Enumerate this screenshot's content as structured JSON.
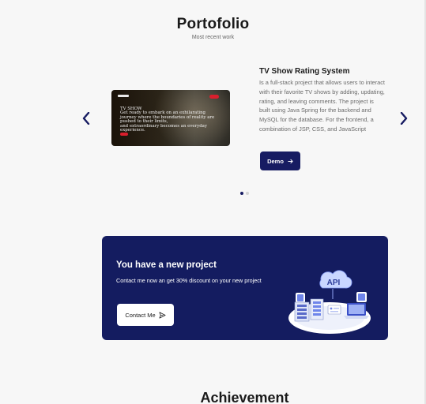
{
  "portfolio": {
    "title": "Portofolio",
    "subtitle": "Most recent work"
  },
  "carousel": {
    "prev_icon": "chevron-left-icon",
    "next_icon": "chevron-right-icon",
    "active_index": 0,
    "total": 2,
    "project": {
      "title": "TV Show Rating System",
      "description": "Is a full-stack project that allows users to interact with their favorite TV shows by adding, updating, rating, and leaving comments. The project is built using Java Spring for the backend and MySQL for the database. For the frontend, a combination of JSP, CSS, and JavaScript",
      "demo_label": "Demo",
      "image_text": "TV SHOW\nGet ready to embark on an exhilarating journey where the boundaries of reality are pushed to their limits,\nand extraordinary becomes an everyday experience."
    }
  },
  "cta": {
    "title": "You have a new project",
    "text": "Contact me now an get 30% discount on your new project",
    "button_label": "Contact Me",
    "illustration_label": "API"
  },
  "achievement": {
    "title": "Achievement"
  },
  "colors": {
    "primary": "#171c62",
    "banner": "#141c60",
    "background": "#f7f7f7",
    "accent_red": "#d91f2d"
  }
}
